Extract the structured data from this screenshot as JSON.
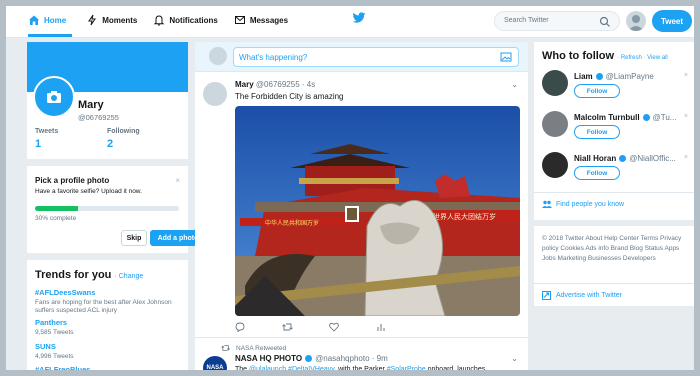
{
  "nav": {
    "home": "Home",
    "moments": "Moments",
    "notifications": "Notifications",
    "messages": "Messages"
  },
  "search": {
    "placeholder": "Search Twitter"
  },
  "tweet_button": "Tweet",
  "profile": {
    "name": "Mary",
    "handle": "@06769255",
    "tweets_label": "Tweets",
    "tweets_count": "1",
    "following_label": "Following",
    "following_count": "2"
  },
  "profile_photo_prompt": {
    "title": "Pick a profile photo",
    "subtitle": "Have a favorite selfie? Upload it now.",
    "progress_fraction": 0.3,
    "complete_text": "30% complete",
    "skip_label": "Skip",
    "add_label": "Add a photo",
    "close": "×"
  },
  "trends": {
    "title": "Trends for you",
    "change": "· Change",
    "items": [
      {
        "tag": "#AFLDeesSwans",
        "desc": "Fans are hoping for the best after Alex Johnson suffers suspected ACL injury"
      },
      {
        "tag": "Panthers",
        "desc": "9,585 Tweets"
      },
      {
        "tag": "SUNS",
        "desc": "4,996 Tweets"
      },
      {
        "tag": "#AFLFreoBlues",
        "desc": ""
      }
    ]
  },
  "compose": {
    "placeholder": "What's happening?"
  },
  "tweet": {
    "name": "Mary",
    "handle": "@06769255",
    "time": "· 4s",
    "text": "The Forbidden City is amazing",
    "image_banner_left": "中华人民共和国万岁",
    "image_banner_right": "世界人民大团结万岁"
  },
  "retweet": {
    "label": "NASA Retweeted",
    "name": "NASA HQ PHOTO",
    "handle": "@nasahqphoto · 9m",
    "avatar_text": "NASA",
    "text_pre": "The ",
    "link1": "@ulalaunch",
    "space1": " ",
    "link2": "#DeltaIVHeavy",
    "text_mid": ", with the Parker ",
    "link3": "#SolarProbe",
    "text_post": " onboard, launches"
  },
  "who_to_follow": {
    "title": "Who to follow",
    "links": "· Refresh · View all",
    "follow_label": "Follow",
    "items": [
      {
        "name": "Liam",
        "handle": "@LiamPayne"
      },
      {
        "name": "Malcolm Turnbull",
        "handle": "@Tu..."
      },
      {
        "name": "Niall Horan",
        "handle": "@NiallOffic..."
      }
    ],
    "find_people": "Find people you know"
  },
  "footer": {
    "text": "© 2018 Twitter  About  Help Center  Terms  Privacy policy  Cookies  Ads info  Brand  Blog  Status  Apps  Jobs  Marketing  Businesses  Developers",
    "advertise": "Advertise with Twitter"
  },
  "colors": {
    "accent": "#1da1f2",
    "background": "#e6ecf0",
    "progress": "#17bf63"
  }
}
